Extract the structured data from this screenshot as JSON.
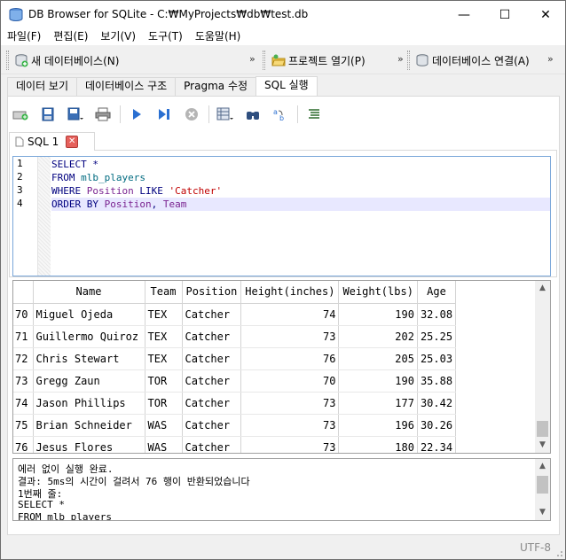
{
  "window": {
    "title": "DB Browser for SQLite - C:₩MyProjects₩db₩test.db",
    "minimize": "—",
    "maximize": "☐",
    "close": "✕"
  },
  "menu": [
    "파일(F)",
    "편집(E)",
    "보기(V)",
    "도구(T)",
    "도움말(H)"
  ],
  "toolbar": {
    "new_db": "새 데이터베이스(N)",
    "open_project": "프로젝트 열기(P)",
    "connect_db": "데이터베이스 연결(A)",
    "more": "»"
  },
  "main_tabs": [
    "데이터 보기",
    "데이터베이스 구조",
    "Pragma 수정",
    "SQL 실행"
  ],
  "sql_tab": {
    "label": "SQL 1",
    "close": "✕"
  },
  "editor": {
    "line_numbers": [
      "1",
      "2",
      "3",
      "4"
    ],
    "lines": [
      [
        {
          "t": "SELECT *",
          "c": "kw"
        }
      ],
      [
        {
          "t": "FROM ",
          "c": "kw"
        },
        {
          "t": "mlb_players",
          "c": "tbl"
        }
      ],
      [
        {
          "t": "WHERE ",
          "c": "kw"
        },
        {
          "t": "Position",
          "c": "col"
        },
        {
          "t": " LIKE ",
          "c": "kw"
        },
        {
          "t": "'Catcher'",
          "c": "str"
        }
      ],
      [
        {
          "t": "ORDER BY ",
          "c": "kw"
        },
        {
          "t": "Position",
          "c": "col"
        },
        {
          "t": ", ",
          "c": "kw"
        },
        {
          "t": "Team",
          "c": "col"
        }
      ]
    ]
  },
  "results": {
    "columns": [
      "Name",
      "Team",
      "Position",
      "Height(inches)",
      "Weight(lbs)",
      "Age"
    ],
    "rows": [
      [
        "70",
        "Miguel Ojeda",
        "TEX",
        "Catcher",
        "74",
        "190",
        "32.08"
      ],
      [
        "71",
        "Guillermo Quiroz",
        "TEX",
        "Catcher",
        "73",
        "202",
        "25.25"
      ],
      [
        "72",
        "Chris Stewart",
        "TEX",
        "Catcher",
        "76",
        "205",
        "25.03"
      ],
      [
        "73",
        "Gregg Zaun",
        "TOR",
        "Catcher",
        "70",
        "190",
        "35.88"
      ],
      [
        "74",
        "Jason Phillips",
        "TOR",
        "Catcher",
        "73",
        "177",
        "30.42"
      ],
      [
        "75",
        "Brian Schneider",
        "WAS",
        "Catcher",
        "73",
        "196",
        "30.26"
      ],
      [
        "76",
        "Jesus Flores",
        "WAS",
        "Catcher",
        "73",
        "180",
        "22.34"
      ]
    ]
  },
  "messages": [
    "에러 없이 실행 완료.",
    "결과: 5ms의 시간이 걸려서 76 행이 반환되었습니다",
    "1번째 줄:",
    "SELECT *",
    "FROM mlb_players"
  ],
  "status": {
    "encoding": "UTF-8"
  },
  "colors": {
    "accent": "#7aa7d9",
    "current_line": "#e8e8ff",
    "close_red": "#e6615c"
  }
}
